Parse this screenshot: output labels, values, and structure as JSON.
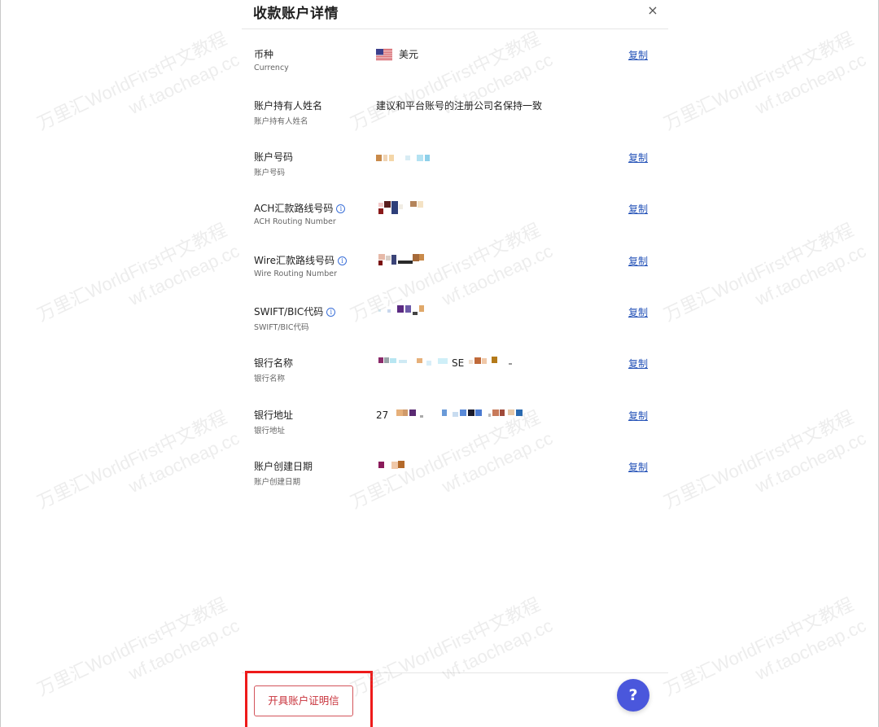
{
  "modal": {
    "title": "收款账户详情",
    "close_symbol": "×"
  },
  "fields": [
    {
      "label": "币种",
      "sublabel": "Currency",
      "value": "美元",
      "flag": "us-flag-icon",
      "copy": "复制"
    },
    {
      "label": "账户持有人姓名",
      "sublabel": "账户持有人姓名",
      "value": "建议和平台账号的注册公司名保持一致"
    },
    {
      "label": "账户号码",
      "sublabel": "账户号码",
      "copy": "复制"
    },
    {
      "label": "ACH汇款路线号码",
      "sublabel": "ACH Routing Number",
      "copy": "复制",
      "info": "i"
    },
    {
      "label": "Wire汇款路线号码",
      "sublabel": "Wire Routing Number",
      "copy": "复制",
      "info": "i"
    },
    {
      "label": "SWIFT/BIC代码",
      "sublabel": "SWIFT/BIC代码",
      "copy": "复制",
      "info": "i"
    },
    {
      "label": "银行名称",
      "sublabel": "银行名称",
      "value_fragment": "SE",
      "copy": "复制"
    },
    {
      "label": "银行地址",
      "sublabel": "银行地址",
      "value_fragment": "27",
      "copy": "复制"
    },
    {
      "label": "账户创建日期",
      "sublabel": "账户创建日期",
      "copy": "复制"
    }
  ],
  "footer": {
    "certificate_button": "开具账户证明信",
    "help_symbol": "?"
  },
  "watermark": {
    "line1": "万里汇WorldFirst中文教程",
    "line2": "wf.taocheap.cc"
  },
  "colors": {
    "link": "#2553b8",
    "danger": "#c8323b",
    "highlight_box": "#ee1a1a",
    "help_button": "#4a57dc"
  }
}
